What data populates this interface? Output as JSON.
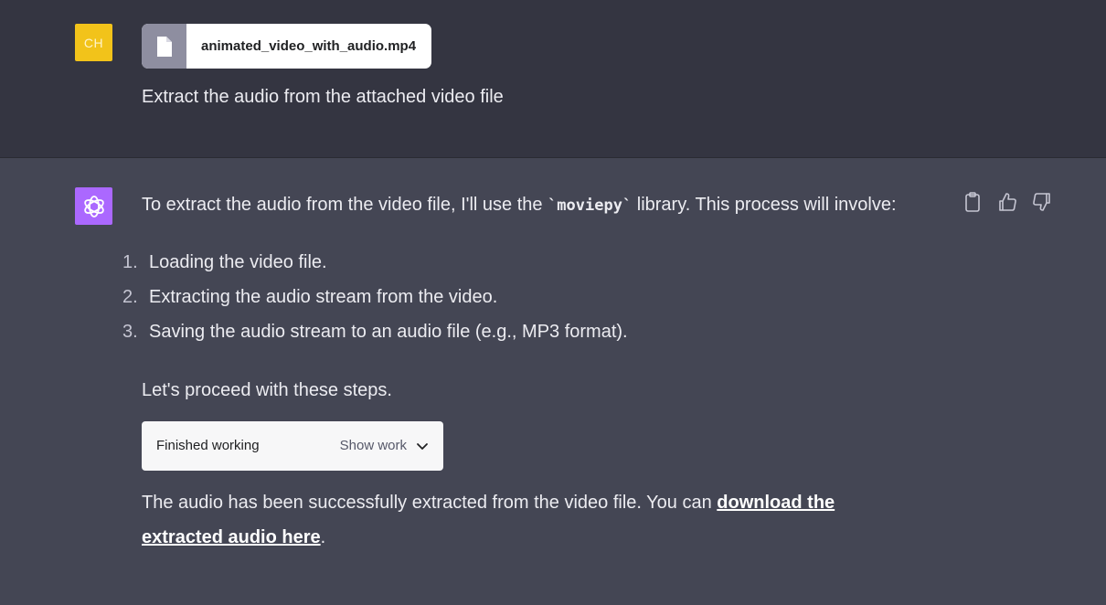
{
  "user": {
    "avatar_initials": "CH",
    "avatar_color": "#f2c31a",
    "attachment": {
      "file_name": "animated_video_with_audio.mp4",
      "icon": "file-icon"
    },
    "message": "Extract the audio from the attached video file"
  },
  "assistant": {
    "avatar_color": "#ab68ff",
    "avatar_icon": "openai-logo-icon",
    "intro_before_code": "To extract the audio from the video file, I'll use the ",
    "intro_code": "`moviepy`",
    "intro_after_code": " library. This process will involve:",
    "steps": [
      {
        "number": "1.",
        "text": "Loading the video file."
      },
      {
        "number": "2.",
        "text": "Extracting the audio stream from the video."
      },
      {
        "number": "3.",
        "text": "Saving the audio stream to an audio file (e.g., MP3 format)."
      }
    ],
    "proceed_text": "Let's proceed with these steps.",
    "work_status": {
      "label": "Finished working",
      "toggle_label": "Show work"
    },
    "result_before_link": "The audio has been successfully extracted from the video file. You can ",
    "result_link": "download the extracted audio here",
    "result_after_link": ".",
    "actions": [
      "clipboard-icon",
      "thumbs-up-icon",
      "thumbs-down-icon"
    ]
  }
}
